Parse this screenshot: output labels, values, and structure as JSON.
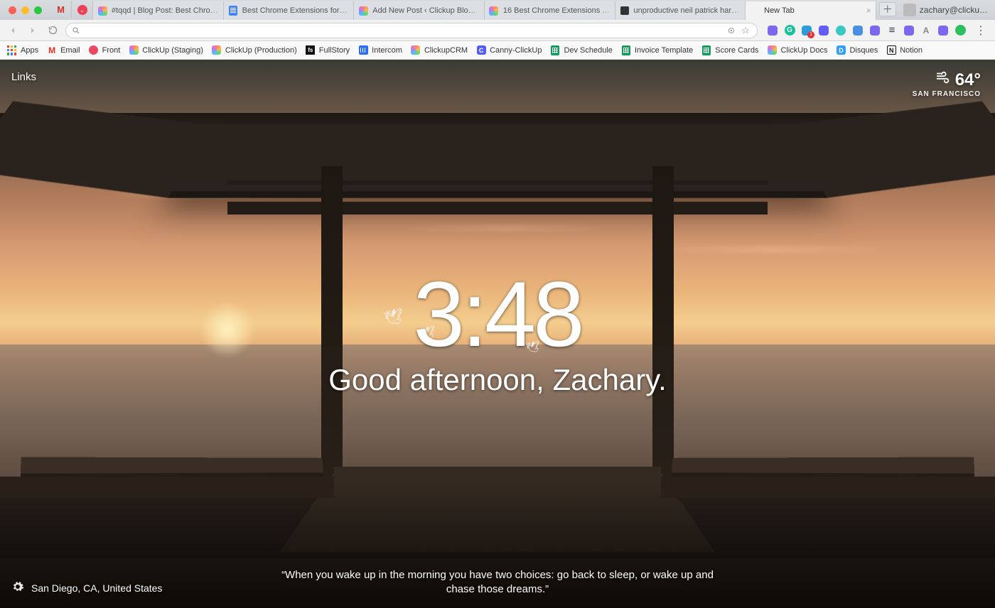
{
  "chrome": {
    "profile": "zachary@clicku…",
    "tabs": [
      {
        "title": "#tqqd | Blog Post: Best Chrom…",
        "favicon": "clickup",
        "active": false
      },
      {
        "title": "Best Chrome Extensions for P…",
        "favicon": "gdoc",
        "active": false
      },
      {
        "title": "Add New Post ‹ Clickup Blog – …",
        "favicon": "clickup",
        "active": false
      },
      {
        "title": "16 Best Chrome Extensions fo…",
        "favicon": "clickup",
        "active": false
      },
      {
        "title": "unproductive neil patrick harri…",
        "favicon": "img",
        "active": false
      },
      {
        "title": "New Tab",
        "favicon": "none",
        "active": true
      }
    ],
    "pinned": [
      {
        "name": "gmail"
      },
      {
        "name": "pocket"
      }
    ],
    "omnibox": {
      "value": ""
    },
    "extensions": [
      {
        "name": "clickup",
        "color": "#7b68ee"
      },
      {
        "name": "grammarly",
        "color": "#15c39a"
      },
      {
        "name": "signal",
        "color": "#2d9cdb",
        "badge": "1"
      },
      {
        "name": "loom",
        "color": "#625df5"
      },
      {
        "name": "circle",
        "color": "#35c9c1"
      },
      {
        "name": "momentum",
        "color": "#4a90e2"
      },
      {
        "name": "clickup2",
        "color": "#7b68ee"
      },
      {
        "name": "buffer",
        "color": "#323b43"
      },
      {
        "name": "clickup3",
        "color": "#7b68ee"
      },
      {
        "name": "aa",
        "color": "#888"
      },
      {
        "name": "clickup4",
        "color": "#7b68ee"
      },
      {
        "name": "evernote",
        "color": "#2dbe60"
      }
    ],
    "bookmarks": [
      {
        "label": "Apps",
        "icon": "apps"
      },
      {
        "label": "Email",
        "icon": "gmail"
      },
      {
        "label": "Front",
        "icon": "front"
      },
      {
        "label": "ClickUp (Staging)",
        "icon": "clickup"
      },
      {
        "label": "ClickUp (Production)",
        "icon": "clickup"
      },
      {
        "label": "FullStory",
        "icon": "fullstory"
      },
      {
        "label": "Intercom",
        "icon": "intercom"
      },
      {
        "label": "ClickupCRM",
        "icon": "clickup"
      },
      {
        "label": "Canny-ClickUp",
        "icon": "canny"
      },
      {
        "label": "Dev Schedule",
        "icon": "gsheet"
      },
      {
        "label": "Invoice Template",
        "icon": "gsheet"
      },
      {
        "label": "Score Cards",
        "icon": "gsheet"
      },
      {
        "label": "ClickUp Docs",
        "icon": "clickup"
      },
      {
        "label": "Disques",
        "icon": "disqus"
      },
      {
        "label": "Notion",
        "icon": "notion"
      }
    ]
  },
  "momentum": {
    "links_label": "Links",
    "weather": {
      "temp": "64°",
      "icon": "wind",
      "city": "SAN FRANCISCO"
    },
    "time": "3:48",
    "greeting": "Good afternoon, Zachary.",
    "photo_location": "San Diego, CA, United States",
    "quote": "“When you wake up in the morning you have two choices: go back to sleep, or wake up and chase those dreams.”"
  }
}
